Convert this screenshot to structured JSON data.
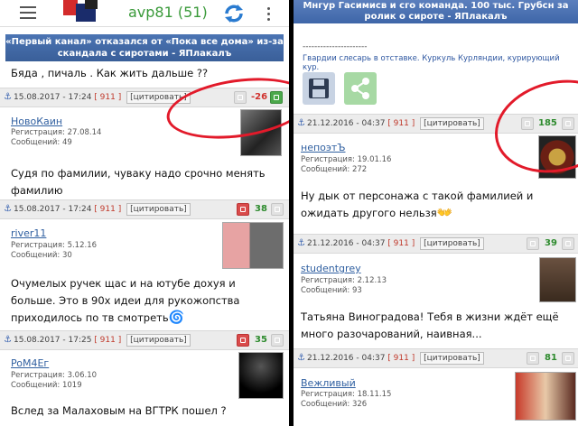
{
  "left": {
    "header": {
      "username": "avp81 (51)"
    },
    "banner": "«Первый канал» отказался от «Пока все дома» из-за скандала с сиротами - ЯПлакалъ",
    "top_text": "Бяда , пичаль . Как жить дальше ??",
    "posts": [
      {
        "date": "15.08.2017 - 17:24",
        "ref": "[ 911 ]",
        "quote": "[цитировать]",
        "score": "-26",
        "author": "НовоКаин",
        "reg": "Регистрация: 27.08.14",
        "msgs": "Сообщений: 49",
        "text": "Судя по фамилии, чуваку надо срочно менять фамилию"
      },
      {
        "date": "15.08.2017 - 17:24",
        "ref": "[ 911 ]",
        "quote": "[цитировать]",
        "score": "38",
        "author": "river11",
        "reg": "Регистрация: 5.12.16",
        "msgs": "Сообщений: 30",
        "text": "Очумелых ручек щас и на ютубе дохуя и больше. Это в 90х идеи для рукожопства приходилось по тв смотреть"
      },
      {
        "date": "15.08.2017 - 17:25",
        "ref": "[ 911 ]",
        "quote": "[цитировать]",
        "score": "35",
        "author": "PoM4Eг",
        "reg": "Регистрация: 3.06.10",
        "msgs": "Сообщений: 1019",
        "text": "Вслед за Малаховым на ВГТРК пошел ?"
      }
    ]
  },
  "right": {
    "banner": "Мнгур Гасимисв и сго команда. 100 тыс. Грубсн за ролик о сироте - ЯПлакалъ",
    "dashes": "----------------------",
    "signature": "Гвардии слесарь в отставке. Куркуль Курляндии, курирующий кур.",
    "posts": [
      {
        "date": "21.12.2016 - 04:37",
        "ref": "[ 911 ]",
        "quote": "[цитировать]",
        "score": "185",
        "author": "непоэтЪ",
        "reg": "Регистрация: 19.01.16",
        "msgs": "Сообщений: 272",
        "text": "Ну дык от персонажа с такой фамилией и ожидать другого нельзя"
      },
      {
        "date": "21.12.2016 - 04:37",
        "ref": "[ 911 ]",
        "quote": "[цитировать]",
        "score": "39",
        "author": "studentgrey",
        "reg": "Регистрация: 2.12.13",
        "msgs": "Сообщений: 93",
        "text": "Татьяна Виноградова! Тебя в жизни ждёт ещё много разочарований, наивная..."
      },
      {
        "date": "21.12.2016 - 04:37",
        "ref": "[ 911 ]",
        "quote": "[цитировать]",
        "score": "81",
        "author": "Вежливый",
        "reg": "Регистрация: 18.11.15",
        "msgs": "Сообщений: 326",
        "text": ""
      }
    ]
  },
  "colors": {
    "accent_blue": "#3a5f99",
    "negative": "#d0312d",
    "positive": "#2e8b2e",
    "annotation": "#e21a2a"
  },
  "icons": [
    "menu-icon",
    "site-logo",
    "refresh-icon",
    "kebab-menu-icon",
    "anchor-icon",
    "vote-down-icon",
    "vote-up-icon",
    "save-icon",
    "share-icon",
    "smile-icon"
  ]
}
